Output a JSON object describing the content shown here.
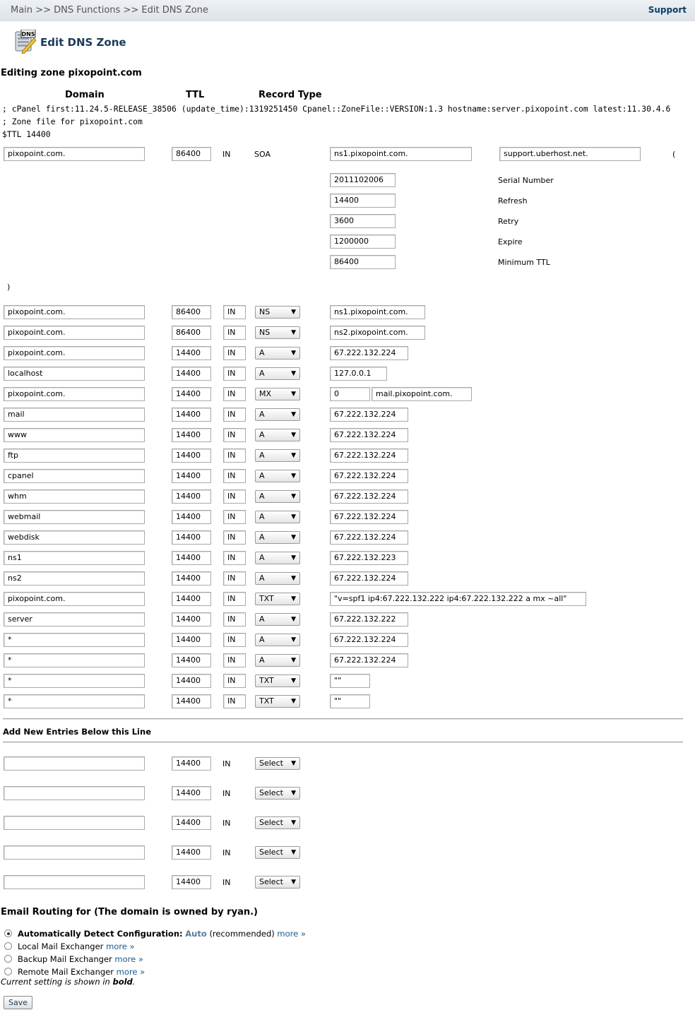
{
  "breadcrumb": {
    "main": "Main",
    "sep1": ">>",
    "section": "DNS Functions",
    "sep2": ">>",
    "current": "Edit DNS Zone"
  },
  "support_label": "Support",
  "page_title": "Edit DNS Zone",
  "icon_text": "DNS",
  "editing_label": "Editing zone pixopoint.com",
  "columns": {
    "domain": "Domain",
    "ttl": "TTL",
    "record_type": "Record Type"
  },
  "zone_comments": [
    "; cPanel first:11.24.5-RELEASE_38506 (update_time):1319251450 Cpanel::ZoneFile::VERSION:1.3 hostname:server.pixopoint.com latest:11.30.4.6",
    "; Zone file for pixopoint.com",
    "$TTL 14400"
  ],
  "soa": {
    "domain": "pixopoint.com.",
    "ttl": "86400",
    "class": "IN",
    "type": "SOA",
    "primary_ns": "ns1.pixopoint.com.",
    "email": "support.uberhost.net.",
    "open_paren": "(",
    "close_paren": ")",
    "fields": [
      {
        "value": "2011102006",
        "label": "Serial Number"
      },
      {
        "value": "14400",
        "label": "Refresh"
      },
      {
        "value": "3600",
        "label": "Retry"
      },
      {
        "value": "1200000",
        "label": "Expire"
      },
      {
        "value": "86400",
        "label": "Minimum TTL"
      }
    ]
  },
  "records": [
    {
      "domain": "pixopoint.com.",
      "ttl": "86400",
      "class": "IN",
      "type": "NS",
      "value": "ns1.pixopoint.com."
    },
    {
      "domain": "pixopoint.com.",
      "ttl": "86400",
      "class": "IN",
      "type": "NS",
      "value": "ns2.pixopoint.com."
    },
    {
      "domain": "pixopoint.com.",
      "ttl": "14400",
      "class": "IN",
      "type": "A",
      "value": "67.222.132.224"
    },
    {
      "domain": "localhost",
      "ttl": "14400",
      "class": "IN",
      "type": "A",
      "value": "127.0.0.1"
    },
    {
      "domain": "pixopoint.com.",
      "ttl": "14400",
      "class": "IN",
      "type": "MX",
      "priority": "0",
      "value": "mail.pixopoint.com."
    },
    {
      "domain": "mail",
      "ttl": "14400",
      "class": "IN",
      "type": "A",
      "value": "67.222.132.224"
    },
    {
      "domain": "www",
      "ttl": "14400",
      "class": "IN",
      "type": "A",
      "value": "67.222.132.224"
    },
    {
      "domain": "ftp",
      "ttl": "14400",
      "class": "IN",
      "type": "A",
      "value": "67.222.132.224"
    },
    {
      "domain": "cpanel",
      "ttl": "14400",
      "class": "IN",
      "type": "A",
      "value": "67.222.132.224"
    },
    {
      "domain": "whm",
      "ttl": "14400",
      "class": "IN",
      "type": "A",
      "value": "67.222.132.224"
    },
    {
      "domain": "webmail",
      "ttl": "14400",
      "class": "IN",
      "type": "A",
      "value": "67.222.132.224"
    },
    {
      "domain": "webdisk",
      "ttl": "14400",
      "class": "IN",
      "type": "A",
      "value": "67.222.132.224"
    },
    {
      "domain": "ns1",
      "ttl": "14400",
      "class": "IN",
      "type": "A",
      "value": "67.222.132.223"
    },
    {
      "domain": "ns2",
      "ttl": "14400",
      "class": "IN",
      "type": "A",
      "value": "67.222.132.224"
    },
    {
      "domain": "pixopoint.com.",
      "ttl": "14400",
      "class": "IN",
      "type": "TXT",
      "value": "\"v=spf1 ip4:67.222.132.222 ip4:67.222.132.222 a mx ~all\""
    },
    {
      "domain": "server",
      "ttl": "14400",
      "class": "IN",
      "type": "A",
      "value": "67.222.132.222"
    },
    {
      "domain": "*",
      "ttl": "14400",
      "class": "IN",
      "type": "A",
      "value": "67.222.132.224"
    },
    {
      "domain": "*",
      "ttl": "14400",
      "class": "IN",
      "type": "A",
      "value": "67.222.132.224"
    },
    {
      "domain": "*",
      "ttl": "14400",
      "class": "IN",
      "type": "TXT",
      "value": "\"\""
    },
    {
      "domain": "*",
      "ttl": "14400",
      "class": "IN",
      "type": "TXT",
      "value": "\"\""
    }
  ],
  "add_new_label": "Add New Entries Below this Line",
  "new_entries": [
    {
      "domain": "",
      "ttl": "14400",
      "class": "IN",
      "type": "Select"
    },
    {
      "domain": "",
      "ttl": "14400",
      "class": "IN",
      "type": "Select"
    },
    {
      "domain": "",
      "ttl": "14400",
      "class": "IN",
      "type": "Select"
    },
    {
      "domain": "",
      "ttl": "14400",
      "class": "IN",
      "type": "Select"
    },
    {
      "domain": "",
      "ttl": "14400",
      "class": "IN",
      "type": "Select"
    }
  ],
  "email_routing": {
    "title": "Email Routing for (The domain is owned by ryan.)",
    "options": [
      {
        "label": "Automatically Detect Configuration:",
        "selected": true,
        "current": "Auto",
        "suffix": "(recommended)",
        "more": "more »"
      },
      {
        "label": "Local Mail Exchanger",
        "selected": false,
        "more": "more »"
      },
      {
        "label": "Backup Mail Exchanger",
        "selected": false,
        "more": "more »"
      },
      {
        "label": "Remote Mail Exchanger",
        "selected": false,
        "more": "more »"
      }
    ],
    "note_prefix": "Current setting is shown in",
    "note_bold": "bold",
    "note_suffix": "."
  },
  "save_label": "Save"
}
